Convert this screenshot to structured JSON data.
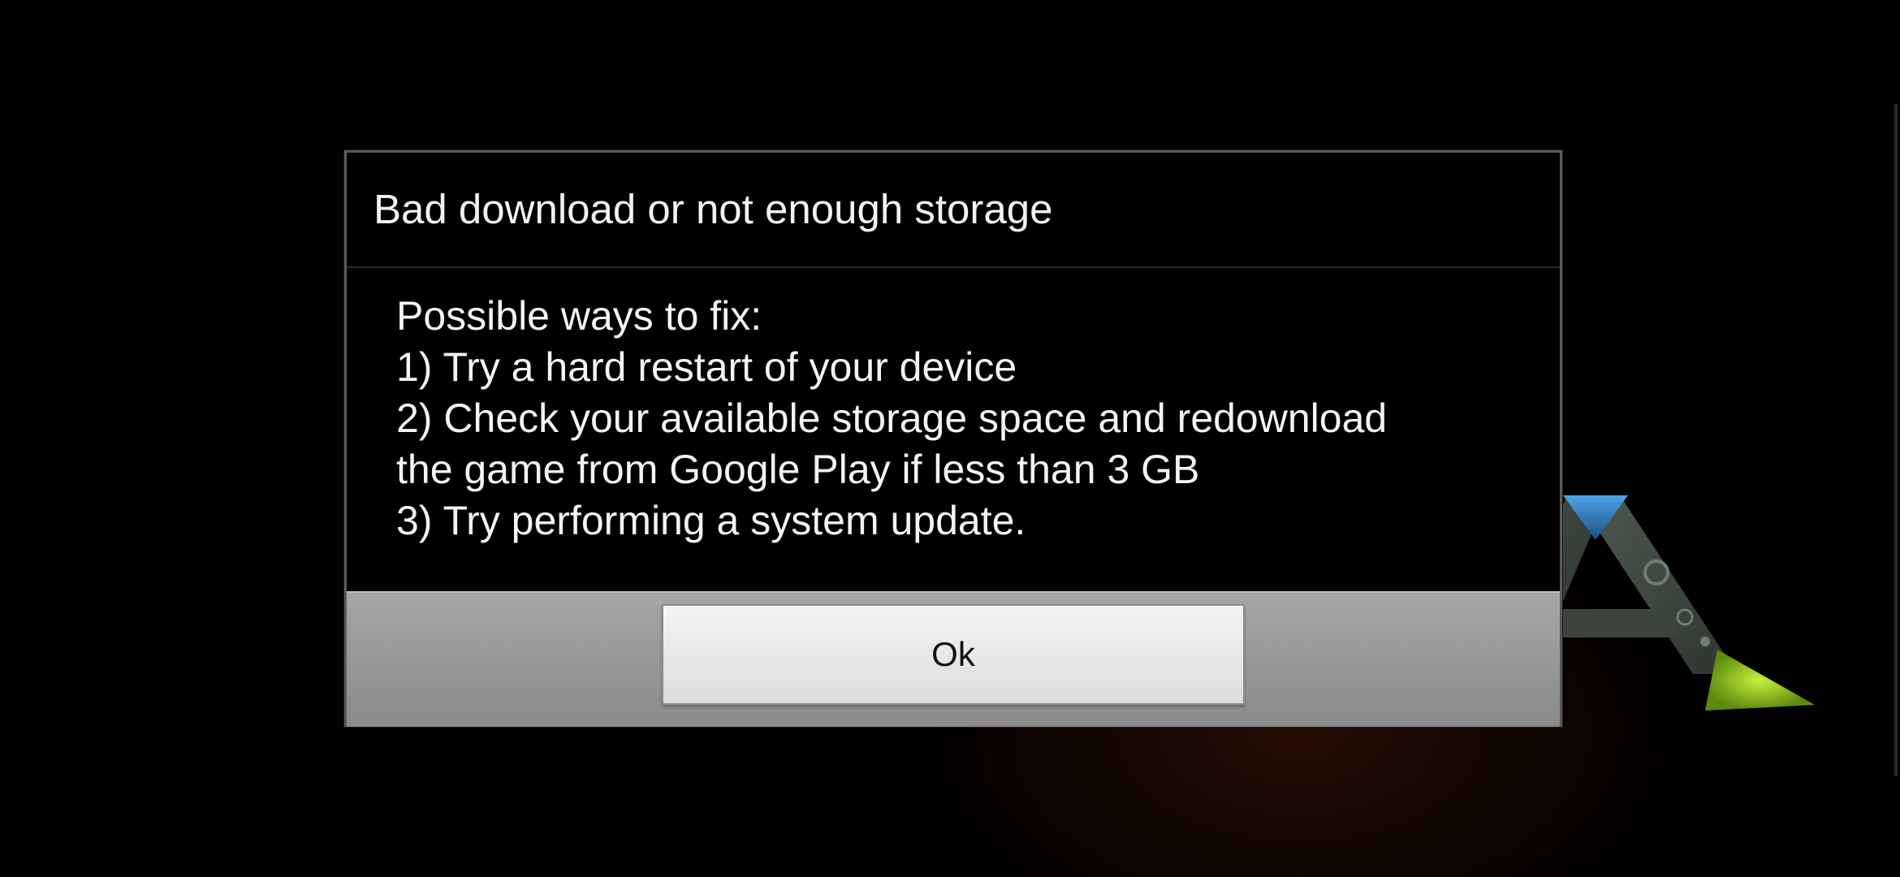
{
  "dialog": {
    "title": "Bad download or not enough storage",
    "body_lines": [
      "Possible ways to fix:",
      "1) Try a hard restart of your device",
      "2) Check your available storage space and redownload",
      "the game from Google Play if less than 3 GB",
      "3) Try performing a system update."
    ],
    "ok_label": "Ok"
  },
  "background": {
    "logo_icon": "ark-logo-icon"
  },
  "colors": {
    "dialog_background": "#000000",
    "button_bar": "#9a9a9a",
    "button_face": "#e8e8e8",
    "logo_blue": "#2a6fb0",
    "logo_green": "#9acd1e"
  }
}
